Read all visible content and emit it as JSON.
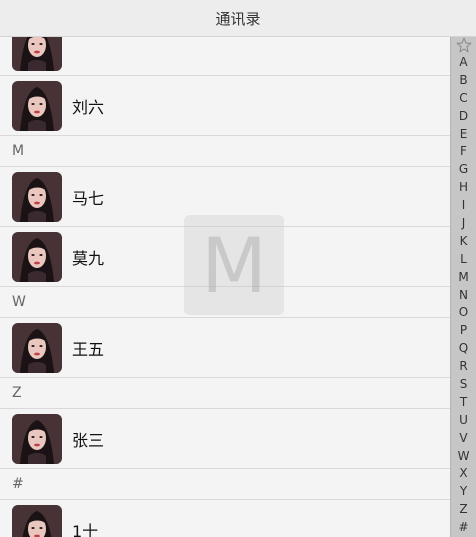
{
  "nav": {
    "title": "通讯录"
  },
  "overlay": {
    "letter": "M"
  },
  "sections": [
    {
      "header": null,
      "contacts": [
        {
          "name": ""
        },
        {
          "name": "刘六"
        }
      ]
    },
    {
      "header": "M",
      "contacts": [
        {
          "name": "马七"
        },
        {
          "name": "莫九"
        }
      ]
    },
    {
      "header": "W",
      "contacts": [
        {
          "name": "王五"
        }
      ]
    },
    {
      "header": "Z",
      "contacts": [
        {
          "name": "张三"
        }
      ]
    },
    {
      "header": "#",
      "contacts": [
        {
          "name": "1十"
        }
      ]
    }
  ],
  "index": {
    "top_icon": "star-icon",
    "letters": [
      "A",
      "B",
      "C",
      "D",
      "E",
      "F",
      "G",
      "H",
      "I",
      "J",
      "K",
      "L",
      "M",
      "N",
      "O",
      "P",
      "Q",
      "R",
      "S",
      "T",
      "U",
      "V",
      "W",
      "X",
      "Y",
      "Z",
      "#"
    ]
  },
  "colors": {
    "index_bg": "#c6c6c6",
    "nav_bg": "#ededed"
  }
}
